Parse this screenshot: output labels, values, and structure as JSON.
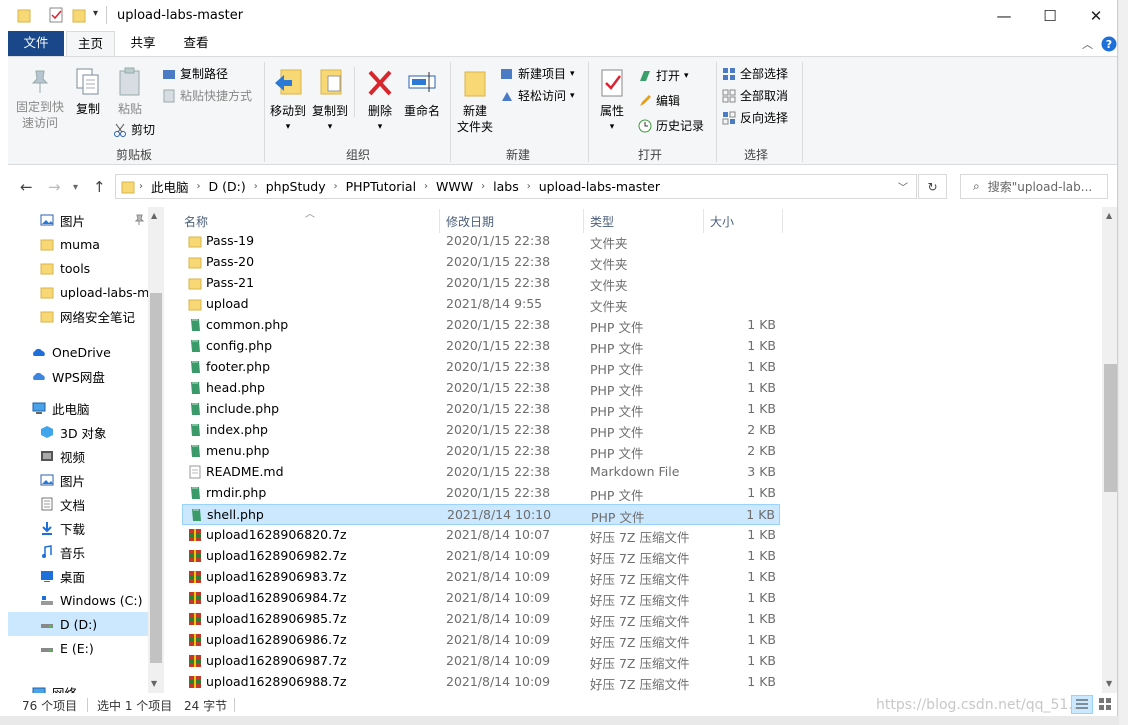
{
  "window": {
    "title": "upload-labs-master"
  },
  "titlebar_buttons": {
    "minimize": "—",
    "maximize": "☐",
    "close": "✕"
  },
  "tabs": {
    "file": "文件",
    "home": "主页",
    "share": "共享",
    "view": "查看"
  },
  "ribbon": {
    "pin": [
      "固定到快",
      "速访问"
    ],
    "copy": "复制",
    "paste": "粘贴",
    "copy_path": "复制路径",
    "paste_shortcut": "粘贴快捷方式",
    "cut": "剪切",
    "clipboard_group": "剪贴板",
    "move_to": "移动到",
    "copy_to": "复制到",
    "delete": "删除",
    "rename": "重命名",
    "organize_group": "组织",
    "new_folder": [
      "新建",
      "文件夹"
    ],
    "new_item": "新建项目",
    "easy_access": "轻松访问",
    "new_group": "新建",
    "properties": "属性",
    "open": "打开",
    "edit": "编辑",
    "history": "历史记录",
    "open_group": "打开",
    "select_all": "全部选择",
    "select_none": "全部取消",
    "invert": "反向选择",
    "select_group": "选择"
  },
  "address": {
    "crumbs": [
      "此电脑",
      "D (D:)",
      "phpStudy",
      "PHPTutorial",
      "WWW",
      "labs",
      "upload-labs-master"
    ],
    "search_placeholder": "搜索\"upload-lab..."
  },
  "nav": [
    {
      "label": "图片",
      "icon": "pictures-icon",
      "indent": 1
    },
    {
      "label": "muma",
      "icon": "folder-icon",
      "indent": 1
    },
    {
      "label": "tools",
      "icon": "folder-icon",
      "indent": 1
    },
    {
      "label": "upload-labs-m",
      "icon": "folder-icon",
      "indent": 1
    },
    {
      "label": "网络安全笔记",
      "icon": "folder-icon",
      "indent": 1
    },
    {
      "label": "OneDrive",
      "icon": "onedrive-icon",
      "indent": 0
    },
    {
      "label": "WPS网盘",
      "icon": "cloud-icon",
      "indent": 0
    },
    {
      "label": "此电脑",
      "icon": "computer-icon",
      "indent": 0
    },
    {
      "label": "3D 对象",
      "icon": "3d-objects-icon",
      "indent": 1
    },
    {
      "label": "视频",
      "icon": "video-icon",
      "indent": 1
    },
    {
      "label": "图片",
      "icon": "pictures-icon",
      "indent": 1
    },
    {
      "label": "文档",
      "icon": "documents-icon",
      "indent": 1
    },
    {
      "label": "下载",
      "icon": "download-icon",
      "indent": 1
    },
    {
      "label": "音乐",
      "icon": "music-icon",
      "indent": 1
    },
    {
      "label": "桌面",
      "icon": "desktop-icon",
      "indent": 1
    },
    {
      "label": "Windows (C:)",
      "icon": "drive-c-icon",
      "indent": 1
    },
    {
      "label": "D (D:)",
      "icon": "drive-icon",
      "indent": 1,
      "selected": true
    },
    {
      "label": "E (E:)",
      "icon": "drive-icon",
      "indent": 1
    },
    {
      "label": "网络",
      "icon": "network-icon",
      "indent": 0
    }
  ],
  "columns": {
    "name": "名称",
    "date": "修改日期",
    "type": "类型",
    "size": "大小"
  },
  "files": [
    {
      "name": "Pass-19",
      "date": "2020/1/15 22:38",
      "type": "文件夹",
      "size": "",
      "icon": "folder-icon"
    },
    {
      "name": "Pass-20",
      "date": "2020/1/15 22:38",
      "type": "文件夹",
      "size": "",
      "icon": "folder-icon"
    },
    {
      "name": "Pass-21",
      "date": "2020/1/15 22:38",
      "type": "文件夹",
      "size": "",
      "icon": "folder-icon"
    },
    {
      "name": "upload",
      "date": "2021/8/14 9:55",
      "type": "文件夹",
      "size": "",
      "icon": "folder-icon"
    },
    {
      "name": "common.php",
      "date": "2020/1/15 22:38",
      "type": "PHP 文件",
      "size": "1 KB",
      "icon": "php-file-icon"
    },
    {
      "name": "config.php",
      "date": "2020/1/15 22:38",
      "type": "PHP 文件",
      "size": "1 KB",
      "icon": "php-file-icon"
    },
    {
      "name": "footer.php",
      "date": "2020/1/15 22:38",
      "type": "PHP 文件",
      "size": "1 KB",
      "icon": "php-file-icon"
    },
    {
      "name": "head.php",
      "date": "2020/1/15 22:38",
      "type": "PHP 文件",
      "size": "1 KB",
      "icon": "php-file-icon"
    },
    {
      "name": "include.php",
      "date": "2020/1/15 22:38",
      "type": "PHP 文件",
      "size": "1 KB",
      "icon": "php-file-icon"
    },
    {
      "name": "index.php",
      "date": "2020/1/15 22:38",
      "type": "PHP 文件",
      "size": "2 KB",
      "icon": "php-file-icon"
    },
    {
      "name": "menu.php",
      "date": "2020/1/15 22:38",
      "type": "PHP 文件",
      "size": "2 KB",
      "icon": "php-file-icon"
    },
    {
      "name": "README.md",
      "date": "2020/1/15 22:38",
      "type": "Markdown File",
      "size": "3 KB",
      "icon": "markdown-file-icon"
    },
    {
      "name": "rmdir.php",
      "date": "2020/1/15 22:38",
      "type": "PHP 文件",
      "size": "1 KB",
      "icon": "php-file-icon"
    },
    {
      "name": "shell.php",
      "date": "2021/8/14 10:10",
      "type": "PHP 文件",
      "size": "1 KB",
      "icon": "php-file-icon",
      "selected": true
    },
    {
      "name": "upload1628906820.7z",
      "date": "2021/8/14 10:07",
      "type": "好压 7Z 压缩文件",
      "size": "1 KB",
      "icon": "archive-icon"
    },
    {
      "name": "upload1628906982.7z",
      "date": "2021/8/14 10:09",
      "type": "好压 7Z 压缩文件",
      "size": "1 KB",
      "icon": "archive-icon"
    },
    {
      "name": "upload1628906983.7z",
      "date": "2021/8/14 10:09",
      "type": "好压 7Z 压缩文件",
      "size": "1 KB",
      "icon": "archive-icon"
    },
    {
      "name": "upload1628906984.7z",
      "date": "2021/8/14 10:09",
      "type": "好压 7Z 压缩文件",
      "size": "1 KB",
      "icon": "archive-icon"
    },
    {
      "name": "upload1628906985.7z",
      "date": "2021/8/14 10:09",
      "type": "好压 7Z 压缩文件",
      "size": "1 KB",
      "icon": "archive-icon"
    },
    {
      "name": "upload1628906986.7z",
      "date": "2021/8/14 10:09",
      "type": "好压 7Z 压缩文件",
      "size": "1 KB",
      "icon": "archive-icon"
    },
    {
      "name": "upload1628906987.7z",
      "date": "2021/8/14 10:09",
      "type": "好压 7Z 压缩文件",
      "size": "1 KB",
      "icon": "archive-icon"
    },
    {
      "name": "upload1628906988.7z",
      "date": "2021/8/14 10:09",
      "type": "好压 7Z 压缩文件",
      "size": "1 KB",
      "icon": "archive-icon"
    }
  ],
  "status": {
    "count": "76 个项目",
    "selected": "选中 1 个项目",
    "size": "24 字节"
  },
  "watermark": "https://blog.csdn.net/qq_51..",
  "colors": {
    "accent": "#19478a",
    "selection": "#cce8ff",
    "selection_border": "#99d1ff",
    "folder": "#f8d775"
  }
}
